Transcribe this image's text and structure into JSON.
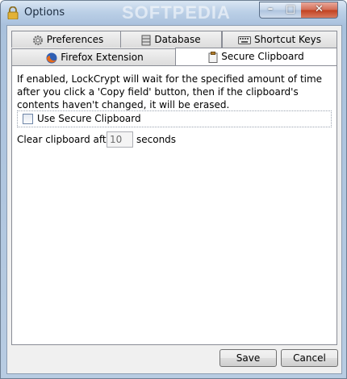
{
  "window": {
    "title": "Options",
    "watermark": "SOFTPEDIA",
    "controls": {
      "minimize": "–",
      "maximize": "□",
      "close": "✕"
    }
  },
  "tabs": [
    {
      "label": "Preferences",
      "icon": "gear-icon",
      "active": false
    },
    {
      "label": "Database",
      "icon": "database-icon",
      "active": false
    },
    {
      "label": "Shortcut Keys",
      "icon": "keyboard-icon",
      "active": false
    },
    {
      "label": "Firefox Extension",
      "icon": "firefox-icon",
      "active": false
    },
    {
      "label": "Secure Clipboard",
      "icon": "clipboard-icon",
      "active": true
    }
  ],
  "secure_clipboard": {
    "description": "If enabled, LockCrypt will wait for the specified amount of time after you click a 'Copy field' button, then if the clipboard's contents haven't changed, it will be erased.",
    "use_label": "Use Secure Clipboard",
    "use_checked": false,
    "clear_label": "Clear clipboard after",
    "seconds_value": "10",
    "seconds_label": "seconds"
  },
  "buttons": {
    "save": "Save",
    "cancel": "Cancel"
  }
}
